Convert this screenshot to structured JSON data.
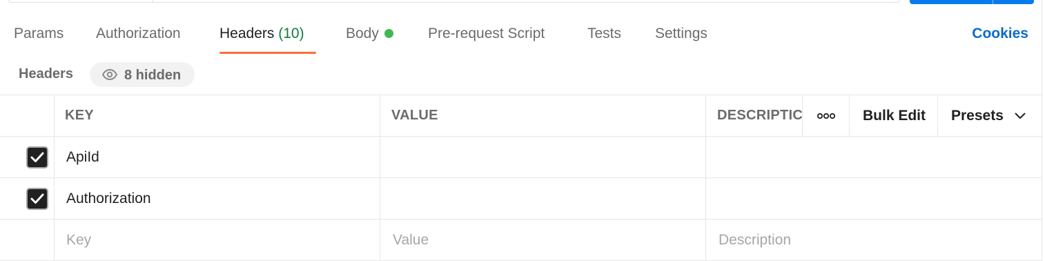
{
  "tabs": [
    {
      "label": "Params"
    },
    {
      "label": "Authorization"
    },
    {
      "label": "Headers",
      "count": "(10)",
      "active": true
    },
    {
      "label": "Body"
    },
    {
      "label": "Pre-request Script"
    },
    {
      "label": "Tests"
    },
    {
      "label": "Settings"
    }
  ],
  "cookies_label": "Cookies",
  "headers_section": {
    "title": "Headers",
    "hidden_label": "8 hidden"
  },
  "table": {
    "columns": {
      "key": "KEY",
      "value": "VALUE",
      "description": "DESCRIPTIC"
    },
    "more_label": "ooo",
    "bulk_edit_label": "Bulk Edit",
    "presets_label": "Presets",
    "rows": [
      {
        "key": "ApiId",
        "checked": true
      },
      {
        "key": "Authorization",
        "checked": true
      }
    ],
    "new_row": {
      "key_placeholder": "Key",
      "value_placeholder": "Value",
      "description_placeholder": "Description"
    }
  },
  "colors": {
    "accent_tab": "#ff6c37",
    "link": "#0b6bcb",
    "count": "#0f7b3f",
    "body_dot": "#3fb950",
    "send": "#097bed"
  }
}
